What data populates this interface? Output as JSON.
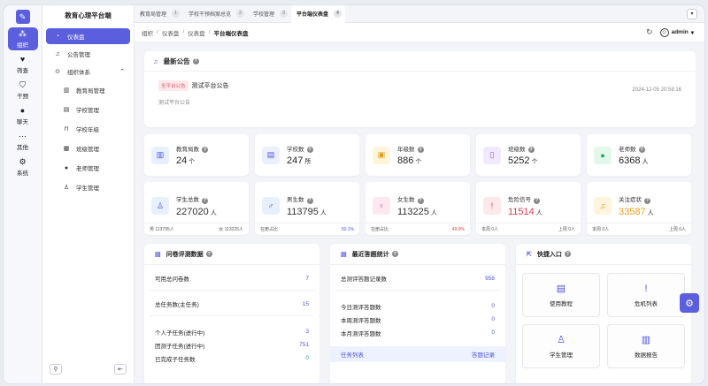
{
  "app": {
    "title": "教育心理平台端"
  },
  "rail": [
    {
      "label": "组织",
      "icon": "org-icon",
      "glyph": "⁂"
    },
    {
      "label": "筛查",
      "icon": "heart-icon",
      "glyph": "♥"
    },
    {
      "label": "干预",
      "icon": "shield-icon",
      "glyph": "⛉"
    },
    {
      "label": "聊天",
      "icon": "chat-icon",
      "glyph": "●"
    },
    {
      "label": "其他",
      "icon": "more-icon",
      "glyph": "⋯"
    },
    {
      "label": "系统",
      "icon": "gear-icon",
      "glyph": "⚙"
    }
  ],
  "nav": {
    "items": [
      {
        "label": "仪表盘",
        "glyph": "◔"
      },
      {
        "label": "公告管理",
        "glyph": "♫"
      },
      {
        "label": "组织体系",
        "glyph": "⊙"
      }
    ],
    "sub": [
      {
        "label": "教育局管理",
        "glyph": "▥"
      },
      {
        "label": "学校管理",
        "glyph": "▤"
      },
      {
        "label": "学校年级",
        "glyph": "⊓"
      },
      {
        "label": "班级管理",
        "glyph": "▦"
      },
      {
        "label": "老师管理",
        "glyph": "●"
      },
      {
        "label": "学生管理",
        "glyph": "♙"
      }
    ]
  },
  "tabs": [
    {
      "label": "教育局管理",
      "num": "1"
    },
    {
      "label": "学校干预档案总览",
      "num": "2"
    },
    {
      "label": "学校管理",
      "num": "3"
    },
    {
      "label": "平台端仪表盘",
      "num": "4"
    }
  ],
  "breadcrumb": [
    "组织",
    "仪表盘",
    "仪表盘",
    "平台端仪表盘"
  ],
  "user": {
    "name": "admin"
  },
  "notice": {
    "title": "最新公告",
    "tag": "全平台公告",
    "headline": "测试平台公告",
    "body": "测试平台公告",
    "date": "2024-12-05 20:58:16"
  },
  "stats_row1": [
    {
      "label": "教育局数",
      "value": "24",
      "unit": "个",
      "glyph": "▥",
      "bg": "#e8f0ff",
      "fg": "#4a55d8"
    },
    {
      "label": "学校数",
      "value": "247",
      "unit": "所",
      "glyph": "▤",
      "bg": "#ecefff",
      "fg": "#4a55d8"
    },
    {
      "label": "年级数",
      "value": "886",
      "unit": "个",
      "glyph": "▣",
      "bg": "#fff4dc",
      "fg": "#e69a17"
    },
    {
      "label": "班级数",
      "value": "5252",
      "unit": "个",
      "glyph": "▯",
      "bg": "#f1e9ff",
      "fg": "#8a58d8"
    },
    {
      "label": "老师数",
      "value": "6368",
      "unit": "人",
      "glyph": "●",
      "bg": "#e3f7ea",
      "fg": "#26a65b"
    }
  ],
  "stats_row2": [
    {
      "label": "学生总数",
      "value": "227020",
      "unit": "人",
      "glyph": "♙",
      "bg": "#e8f0ff",
      "fg": "#4a55d8",
      "color": "",
      "foot_l": "男 113795人",
      "foot_r": "女 113225人"
    },
    {
      "label": "男生数",
      "value": "113795",
      "unit": "人",
      "glyph": "♂",
      "bg": "#e8f0ff",
      "fg": "#4a55d8",
      "color": "",
      "foot_l": "在册占比",
      "foot_r": "50.1%"
    },
    {
      "label": "女生数",
      "value": "113225",
      "unit": "人",
      "glyph": "♀",
      "bg": "#fde8f1",
      "fg": "#d8458a",
      "color": "",
      "foot_l": "在册占比",
      "foot_r": "49.9%"
    },
    {
      "label": "危险信号",
      "value": "11514",
      "unit": "人",
      "glyph": "!",
      "bg": "#fde8ea",
      "fg": "#e43d4d",
      "color": "red",
      "foot_l": "本周 0人",
      "foot_r": "上周 0人"
    },
    {
      "label": "关注症状",
      "value": "33587",
      "unit": "人",
      "glyph": "♫",
      "bg": "#fff4dc",
      "fg": "#e69a17",
      "color": "orange",
      "foot_l": "本周 0人",
      "foot_r": "上周 0人"
    }
  ],
  "survey": {
    "title": "问卷评测数据",
    "rows_a": [
      {
        "k": "可用总问卷数",
        "v": "7"
      },
      {
        "k": "总任务数(主任务)",
        "v": "15"
      }
    ],
    "rows_b": [
      {
        "k": "个人子任务(进行中)",
        "v": "3"
      },
      {
        "k": "团测子任务(进行中)",
        "v": "751"
      },
      {
        "k": "已完成子任务数",
        "v": "0"
      }
    ]
  },
  "answers": {
    "title": "最近答题统计",
    "total_k": "总测评答题记录数",
    "total_v": "958",
    "rows": [
      {
        "k": "今日测评答题数",
        "v": "0"
      },
      {
        "k": "本周测评答题数",
        "v": "0"
      },
      {
        "k": "本月测评答题数",
        "v": "0"
      }
    ],
    "foot_l": "任务列表",
    "foot_r": "答题记录"
  },
  "quick": {
    "title": "快捷入口",
    "items": [
      {
        "label": "使用教程",
        "glyph": "▤",
        "icon": "document-icon"
      },
      {
        "label": "危机列表",
        "glyph": "!",
        "icon": "alert-icon"
      },
      {
        "label": "学生管理",
        "glyph": "♙",
        "icon": "user-icon"
      },
      {
        "label": "数据报告",
        "glyph": "▥",
        "icon": "report-icon"
      }
    ]
  }
}
